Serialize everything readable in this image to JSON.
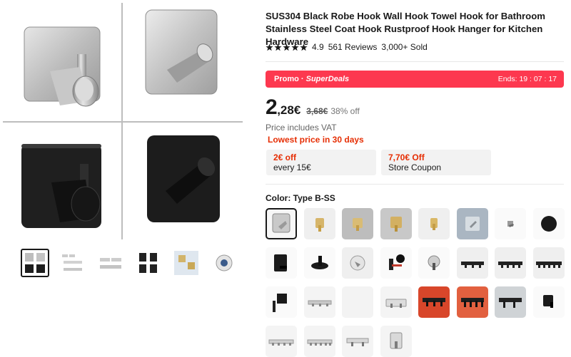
{
  "product": {
    "title": "SUS304 Black Robe Hook Wall Hook Towel Hook for Bathroom Stainless Steel Coat Hook Rustproof Hook Hanger for Kitchen Hardware",
    "rating": {
      "score": "4.9",
      "stars": 5,
      "reviews": "561 Reviews",
      "sold": "3,000+ Sold"
    }
  },
  "promo": {
    "label_prefix": "Promo · ",
    "label_name": "SuperDeals",
    "ends": "Ends: 19 : 07 : 17"
  },
  "price": {
    "integer": "2",
    "decimal": ",28€",
    "original": "3,68€",
    "discount": "38% off",
    "vat": "Price includes VAT",
    "lowest": "Lowest price in 30 days"
  },
  "coupons": [
    {
      "title": "2€ off",
      "desc": "every 15€"
    },
    {
      "title": "7,70€ Off",
      "desc": "Store Coupon"
    }
  ],
  "color": {
    "label": "Color: Type B-SS"
  },
  "gallery": {
    "main_icons": [
      "silver-round-hook-image",
      "silver-angled-hook-image",
      "black-round-hook-image",
      "black-angled-hook-image"
    ],
    "thumbnails": [
      "four-hooks-thumb",
      "multi-hooks-thumb",
      "rail-hooks-thumb",
      "black-hooks-thumb",
      "gold-hooks-thumb",
      "round-hook-thumb"
    ]
  },
  "swatches": [
    "silver-square-hook",
    "gold-hook-1",
    "gold-hook-2",
    "gold-hook-3",
    "gold-hook-4",
    "silver-hook-photo",
    "small-silver-hook",
    "black-round-hook",
    "black-square-hook",
    "black-angled-hook",
    "silver-round-hook",
    "black-knob-hook",
    "silver-knob-hook",
    "black-rail-3",
    "black-rail-4",
    "black-rail-5",
    "black-wall-hook",
    "silver-rail-3",
    "blank-swatch",
    "silver-rail-2",
    "black-rail-red",
    "black-rail-orange",
    "black-rail-grey",
    "black-single-hook",
    "silver-rail-4a",
    "silver-rail-4b",
    "silver-rail-2b",
    "silver-single-hook"
  ],
  "colors": {
    "accent": "#fd384f",
    "price_red": "#e62e04",
    "text": "#191919"
  }
}
